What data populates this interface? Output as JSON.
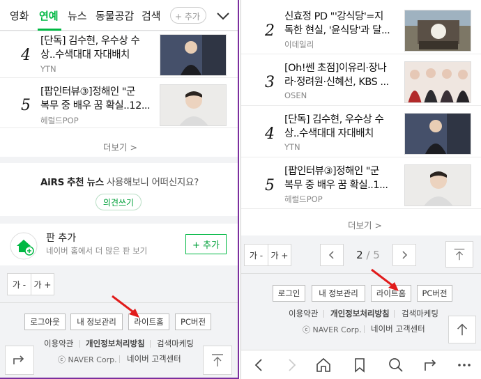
{
  "left": {
    "tabs": [
      "영화",
      "연예",
      "뉴스",
      "동물공감",
      "검색"
    ],
    "add_tab_label": "+ 추가",
    "news": [
      {
        "rank": "4",
        "title_line1": "[단독] 김수현, 우수상 수",
        "title_line2": "상..수색대대 자대배치",
        "press": "YTN"
      },
      {
        "rank": "5",
        "title_line1": "[팝인터뷰③]정해인 \"군",
        "title_line2": "복무 중 배우 꿈 확실..12...",
        "press": "헤럴드POP"
      }
    ],
    "more_label": "더보기 >",
    "airs": {
      "brand": "AiRS",
      "title": "추천 뉴스",
      "desc": "사용해보니 어떠신지요?",
      "button": "의견쓰기"
    },
    "pan": {
      "title": "판 추가",
      "desc": "네이버 홈에서 더 많은 판 보기",
      "button": "+ 추가"
    },
    "font_ctl": {
      "minus": "가 -",
      "plus": "가 +"
    },
    "footer": {
      "buttons": [
        "로그아웃",
        "내 정보관리",
        "라이트홈",
        "PC버전"
      ],
      "links": [
        "이용약관",
        "개인정보처리방침",
        "검색마케팅"
      ],
      "copyright": "ⓒ NAVER Corp.",
      "support": "네이버 고객센터"
    }
  },
  "right": {
    "news": [
      {
        "rank": "2",
        "title_line1": "신효정 PD \"'강식당'=지",
        "title_line2": "독한 현실, '윤식당'과 달...",
        "press": "이데일리"
      },
      {
        "rank": "3",
        "title_line1": "[Oh!쎈 초점]이유리·장나",
        "title_line2": "라·정려원·신혜선, KBS ...",
        "press": "OSEN"
      },
      {
        "rank": "4",
        "title_line1": "[단독] 김수현, 우수상 수",
        "title_line2": "상..수색대대 자대배치",
        "press": "YTN"
      },
      {
        "rank": "5",
        "title_line1": "[팝인터뷰③]정해인 \"군",
        "title_line2": "복무 중 배우 꿈 확실..1...",
        "press": "헤럴드POP"
      }
    ],
    "more_label": "더보기 >",
    "font_ctl": {
      "minus": "가 -",
      "plus": "가 +"
    },
    "pager": {
      "current": "2",
      "separator": " / ",
      "total": "5"
    },
    "footer": {
      "buttons": [
        "로그인",
        "내 정보관리",
        "라이트홈",
        "PC버전"
      ],
      "links": [
        "이용약관",
        "개인정보처리방침",
        "검색마케팅"
      ],
      "copyright": "ⓒ NAVER Corp.",
      "support": "네이버 고객센터"
    }
  },
  "colors": {
    "accent_green": "#00b843",
    "annotation_red": "#e11b1b",
    "frame_purple": "#7b2e9e"
  }
}
